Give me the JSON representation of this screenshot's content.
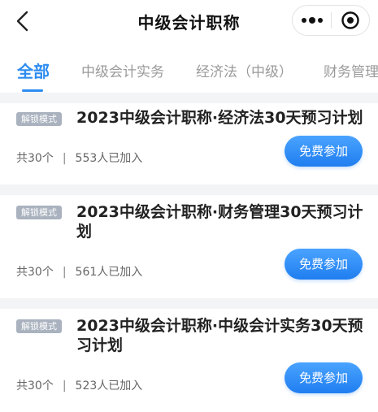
{
  "header": {
    "title": "中级会计职称",
    "back_icon": "chevron-left-icon",
    "more_icon": "more-dots-icon",
    "close_icon": "target-close-icon"
  },
  "tabs": [
    {
      "label": "全部",
      "active": true
    },
    {
      "label": "中级会计实务",
      "active": false
    },
    {
      "label": "经济法（中级）",
      "active": false
    },
    {
      "label": "财务管理",
      "active": false
    }
  ],
  "courses": [
    {
      "badge": "解锁模式",
      "title": "2023中级会计职称·经济法30天预习计划",
      "count": "共30个",
      "joined": "553人已加入",
      "button": "免费参加"
    },
    {
      "badge": "解锁模式",
      "title": "2023中级会计职称·财务管理30天预习计划",
      "count": "共30个",
      "joined": "561人已加入",
      "button": "免费参加"
    },
    {
      "badge": "解锁模式",
      "title": "2023中级会计职称·中级会计实务30天预习计划",
      "count": "共30个",
      "joined": "523人已加入",
      "button": "免费参加"
    }
  ],
  "meta_divider": "|",
  "colors": {
    "accent": "#2d8cf0",
    "badge_bg": "#a9b2be",
    "gap_bg": "#f3f4f6"
  }
}
